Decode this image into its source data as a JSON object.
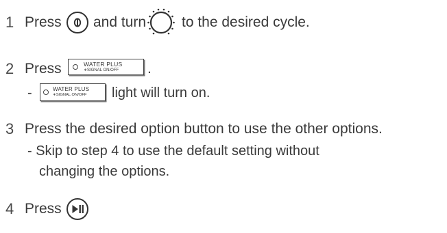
{
  "steps": [
    {
      "number": "1",
      "press": "Press",
      "and_turn": "and turn",
      "rest": "to the desired cycle.",
      "power_icon": "power-button-icon",
      "dial_icon": "cycle-dial-icon"
    },
    {
      "number": "2",
      "press": "Press",
      "period": ".",
      "button": {
        "top": "WATER PLUS",
        "bottom": "∗SIGNAL ON/OFF"
      },
      "note_dash": "-",
      "note_text": "light will turn on."
    },
    {
      "number": "3",
      "text": "Press the desired option button to use the other options.",
      "note_line1": "- Skip to step 4 to use the default setting without",
      "note_line2": "changing the options."
    },
    {
      "number": "4",
      "press": "Press",
      "start_icon": "start-pause-icon"
    }
  ],
  "colors": {
    "text": "#3a3a3a",
    "icon_stroke": "#333333"
  }
}
